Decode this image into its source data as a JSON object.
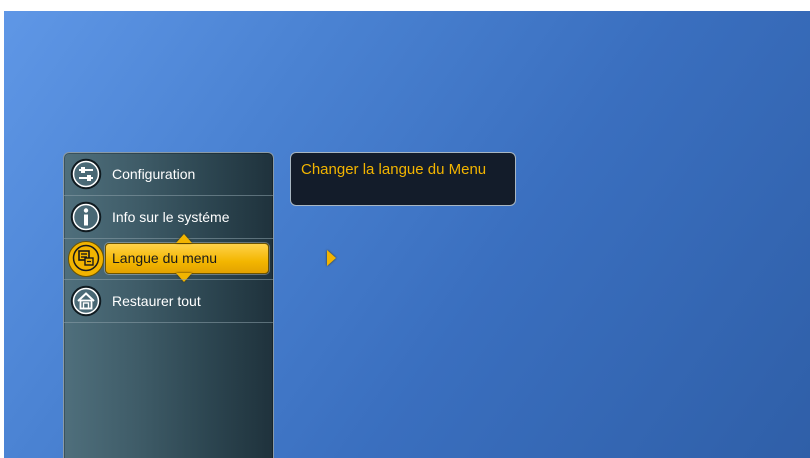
{
  "menu": {
    "items": [
      {
        "label": "Configuration",
        "icon": "sliders-icon",
        "selected": false
      },
      {
        "label": "Info sur le systéme",
        "icon": "info-icon",
        "selected": false
      },
      {
        "label": "Langue du menu",
        "icon": "language-icon",
        "selected": true
      },
      {
        "label": "Restaurer tout",
        "icon": "home-icon",
        "selected": false
      }
    ]
  },
  "tooltip": {
    "text": "Changer la langue du Menu"
  },
  "colors": {
    "accent": "#f2b400",
    "background": "#3a6fbf",
    "panel": "#2c4550",
    "tooltip_bg": "#131c2a"
  }
}
